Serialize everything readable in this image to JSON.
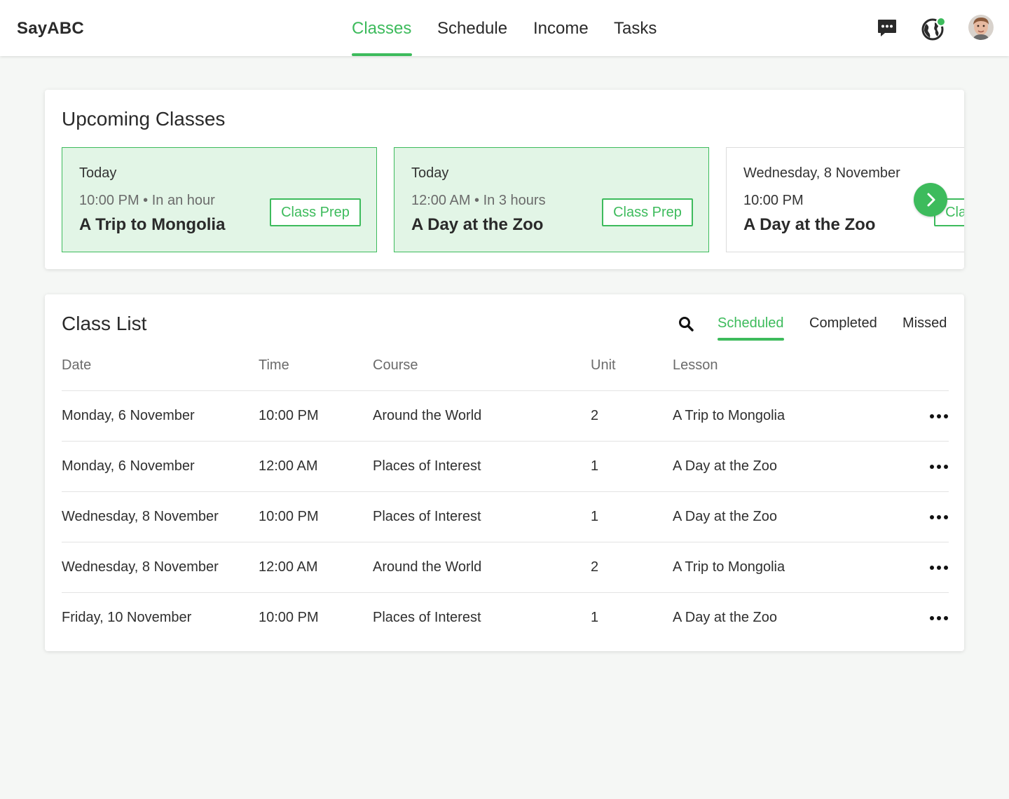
{
  "header": {
    "brand": "SayABC",
    "nav": [
      {
        "label": "Classes",
        "active": true
      },
      {
        "label": "Schedule",
        "active": false
      },
      {
        "label": "Income",
        "active": false
      },
      {
        "label": "Tasks",
        "active": false
      }
    ],
    "icons": [
      "chat-icon",
      "globe-icon",
      "avatar"
    ],
    "accent_color": "#3dbb5c"
  },
  "upcoming": {
    "title": "Upcoming Classes",
    "classes": [
      {
        "day": "Today",
        "time": "10:00 PM • In an hour",
        "lesson": "A Trip to Mongolia",
        "button": "Class Prep"
      },
      {
        "day": "Today",
        "time": "12:00 AM • In 3 hours",
        "lesson": "A Day at the Zoo",
        "button": "Class Prep"
      },
      {
        "day": "Wednesday, 8 November",
        "time": "10:00 PM",
        "lesson": "A Day at the Zoo",
        "button": "Class Prep"
      }
    ]
  },
  "class_list": {
    "title": "Class List",
    "filters": [
      {
        "label": "Scheduled",
        "active": true
      },
      {
        "label": "Completed",
        "active": false
      },
      {
        "label": "Missed",
        "active": false
      }
    ],
    "columns": [
      "Date",
      "Time",
      "Course",
      "Unit",
      "Lesson"
    ],
    "rows": [
      {
        "date": "Monday, 6 November",
        "time": "10:00 PM",
        "course": "Around the World",
        "unit": "2",
        "lesson": "A Trip to Mongolia"
      },
      {
        "date": "Monday, 6 November",
        "time": "12:00 AM",
        "course": "Places of Interest",
        "unit": "1",
        "lesson": "A Day at the Zoo"
      },
      {
        "date": "Wednesday, 8 November",
        "time": "10:00 PM",
        "course": "Places of Interest",
        "unit": "1",
        "lesson": "A Day at the Zoo"
      },
      {
        "date": "Wednesday, 8 November",
        "time": "12:00 AM",
        "course": "Around the World",
        "unit": "2",
        "lesson": "A Trip to Mongolia"
      },
      {
        "date": "Friday, 10 November",
        "time": "10:00 PM",
        "course": "Places of Interest",
        "unit": "1",
        "lesson": "A Day at the Zoo"
      }
    ]
  }
}
